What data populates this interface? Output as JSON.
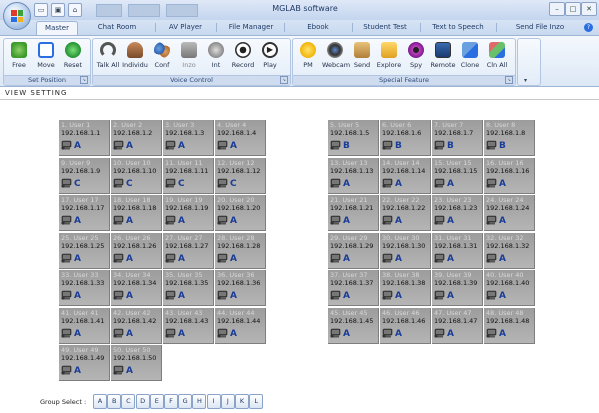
{
  "app": {
    "title": "MGLAB software"
  },
  "window_controls": [
    "–",
    "□",
    "✕"
  ],
  "tabs": [
    "Master",
    "Chat Room",
    "AV Player",
    "File Manager",
    "Ebook",
    "Student Test",
    "Text to Speech",
    "Send File Inzo"
  ],
  "ribbon": {
    "groups": [
      {
        "label": "Set Position",
        "buttons": [
          {
            "label": "Free",
            "icon": "free-position-icon"
          },
          {
            "label": "Move",
            "icon": "move-icon"
          },
          {
            "label": "Reset",
            "icon": "reset-icon"
          }
        ]
      },
      {
        "label": "Voice Control",
        "buttons": [
          {
            "label": "Talk All",
            "icon": "talk-all-icon"
          },
          {
            "label": "Individu",
            "icon": "individual-icon"
          },
          {
            "label": "Conf",
            "icon": "conference-icon"
          },
          {
            "label": "Inzo",
            "icon": "inzo-icon"
          },
          {
            "label": "Int",
            "icon": "intercom-icon"
          },
          {
            "label": "Record",
            "icon": "record-icon"
          },
          {
            "label": "Play",
            "icon": "play-icon"
          }
        ]
      },
      {
        "label": "Special Feature",
        "buttons": [
          {
            "label": "PM",
            "icon": "smiley-icon"
          },
          {
            "label": "Webcam",
            "icon": "webcam-icon"
          },
          {
            "label": "Send",
            "icon": "send-icon"
          },
          {
            "label": "Explore",
            "icon": "folder-icon"
          },
          {
            "label": "Spy",
            "icon": "eye-icon"
          },
          {
            "label": "Remote",
            "icon": "monitor-icon"
          },
          {
            "label": "Clone",
            "icon": "clone-icon"
          },
          {
            "label": "Cln All",
            "icon": "clone-all-icon"
          }
        ]
      }
    ]
  },
  "view_setting_label": "VIEW SETTING",
  "users": [
    {
      "name": "1. User 1",
      "ip": "192.168.1.1",
      "group": "A"
    },
    {
      "name": "2. User 2",
      "ip": "192.168.1.2",
      "group": "A"
    },
    {
      "name": "3. User 3",
      "ip": "192.168.1.3",
      "group": "A"
    },
    {
      "name": "4. User 4",
      "ip": "192.168.1.4",
      "group": "A"
    },
    {
      "name": "5. User 5",
      "ip": "192.168.1.5",
      "group": "B"
    },
    {
      "name": "6. User 6",
      "ip": "192.168.1.6",
      "group": "B"
    },
    {
      "name": "7. User 7",
      "ip": "192.168.1.7",
      "group": "B"
    },
    {
      "name": "8. User 8",
      "ip": "192.168.1.8",
      "group": "B"
    },
    {
      "name": "9. User 9",
      "ip": "192.168.1.9",
      "group": "C"
    },
    {
      "name": "10. User 10",
      "ip": "192.168.1.10",
      "group": "C"
    },
    {
      "name": "11. User 11",
      "ip": "192.168.1.11",
      "group": "C"
    },
    {
      "name": "12. User 12",
      "ip": "192.168.1.12",
      "group": "C"
    },
    {
      "name": "13. User 13",
      "ip": "192.168.1.13",
      "group": "A"
    },
    {
      "name": "14. User 14",
      "ip": "192.168.1.14",
      "group": "A"
    },
    {
      "name": "15. User 15",
      "ip": "192.168.1.15",
      "group": "A"
    },
    {
      "name": "16. User 16",
      "ip": "192.168.1.16",
      "group": "A"
    },
    {
      "name": "17. User 17",
      "ip": "192.168.1.17",
      "group": "A"
    },
    {
      "name": "18. User 18",
      "ip": "192.168.1.18",
      "group": "A"
    },
    {
      "name": "19. User 19",
      "ip": "192.168.1.19",
      "group": "A"
    },
    {
      "name": "20. User 20",
      "ip": "192.168.1.20",
      "group": "A"
    },
    {
      "name": "21. User 21",
      "ip": "192.168.1.21",
      "group": "A"
    },
    {
      "name": "22. User 22",
      "ip": "192.168.1.22",
      "group": "A"
    },
    {
      "name": "23. User 23",
      "ip": "192.168.1.23",
      "group": "A"
    },
    {
      "name": "24. User 24",
      "ip": "192.168.1.24",
      "group": "A"
    },
    {
      "name": "25. User 25",
      "ip": "192.168.1.25",
      "group": "A"
    },
    {
      "name": "26. User 26",
      "ip": "192.168.1.26",
      "group": "A"
    },
    {
      "name": "27. User 27",
      "ip": "192.168.1.27",
      "group": "A"
    },
    {
      "name": "28. User 28",
      "ip": "192.168.1.28",
      "group": "A"
    },
    {
      "name": "29. User 29",
      "ip": "192.168.1.29",
      "group": "A"
    },
    {
      "name": "30. User 30",
      "ip": "192.168.1.30",
      "group": "A"
    },
    {
      "name": "31. User 31",
      "ip": "192.168.1.31",
      "group": "A"
    },
    {
      "name": "32. User 32",
      "ip": "192.168.1.32",
      "group": "A"
    },
    {
      "name": "33. User 33",
      "ip": "192.168.1.33",
      "group": "A"
    },
    {
      "name": "34. User 34",
      "ip": "192.168.1.34",
      "group": "A"
    },
    {
      "name": "35. User 35",
      "ip": "192.168.1.35",
      "group": "A"
    },
    {
      "name": "36. User 36",
      "ip": "192.168.1.36",
      "group": "A"
    },
    {
      "name": "37. User 37",
      "ip": "192.168.1.37",
      "group": "A"
    },
    {
      "name": "38. User 38",
      "ip": "192.168.1.38",
      "group": "A"
    },
    {
      "name": "39. User 39",
      "ip": "192.168.1.39",
      "group": "A"
    },
    {
      "name": "40. User 40",
      "ip": "192.168.1.40",
      "group": "A"
    },
    {
      "name": "41. User 41",
      "ip": "192.168.1.41",
      "group": "A"
    },
    {
      "name": "42. User 42",
      "ip": "192.168.1.42",
      "group": "A"
    },
    {
      "name": "43. User 43",
      "ip": "192.168.1.43",
      "group": "A"
    },
    {
      "name": "44. User 44",
      "ip": "192.168.1.44",
      "group": "A"
    },
    {
      "name": "45. User 45",
      "ip": "192.168.1.45",
      "group": "A"
    },
    {
      "name": "46. User 46",
      "ip": "192.168.1.46",
      "group": "A"
    },
    {
      "name": "47. User 47",
      "ip": "192.168.1.47",
      "group": "A"
    },
    {
      "name": "48. User 48",
      "ip": "192.168.1.48",
      "group": "A"
    },
    {
      "name": "49. User 49",
      "ip": "192.168.1.49",
      "group": "A"
    },
    {
      "name": "50. User 50",
      "ip": "192.168.1.50",
      "group": "A"
    }
  ],
  "group_select": {
    "label": "Group Select :",
    "options": [
      "A",
      "B",
      "C",
      "D",
      "E",
      "F",
      "G",
      "H",
      "I",
      "J",
      "K",
      "L"
    ]
  },
  "colors": {
    "group_letter": "#1a3d99",
    "card_bg": "#a8a8a8",
    "accent": "#2a6fe2"
  }
}
